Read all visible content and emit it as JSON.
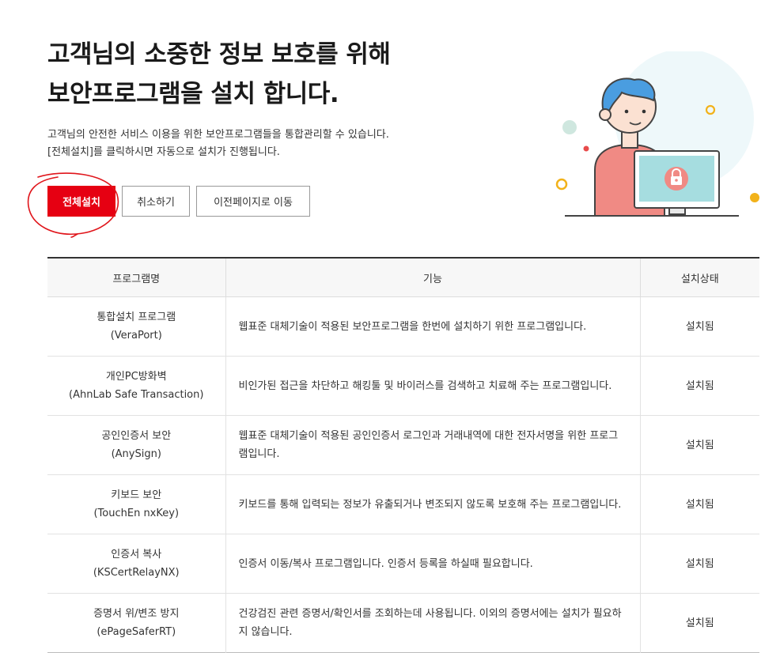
{
  "header": {
    "title_line1": "고객님의 소중한 정보 보호를 위해",
    "title_line2": "보안프로그램을 설치 합니다.",
    "desc_line1": "고객님의 안전한 서비스 이용을 위한 보안프로그램들을 통합관리할 수 있습니다.",
    "desc_line2": "[전체설치]를 클릭하시면 자동으로 설치가 진행됩니다."
  },
  "buttons": {
    "install_all": "전체설치",
    "cancel": "취소하기",
    "back": "이전페이지로 이동"
  },
  "colors": {
    "accent": "#e60012",
    "annotation": "#e0151b",
    "illust_shirt": "#f08a84",
    "illust_hair": "#4a9de0",
    "illust_screen": "#a6dde0"
  },
  "table": {
    "headers": [
      "프로그램명",
      "기능",
      "설치상태"
    ],
    "rows": [
      {
        "name": "통합설치 프로그램",
        "code": "(VeraPort)",
        "func": "웹표준 대체기술이 적용된 보안프로그램을 한번에 설치하기 위한 프로그램입니다.",
        "status": "설치됨"
      },
      {
        "name": "개인PC방화벽",
        "code": "(AhnLab Safe Transaction)",
        "func": "비인가된 접근을 차단하고 해킹툴 및 바이러스를 검색하고 치료해 주는 프로그램입니다.",
        "status": "설치됨"
      },
      {
        "name": "공인인증서 보안",
        "code": "(AnySign)",
        "func": "웹표준 대체기술이 적용된 공인인증서 로그인과 거래내역에 대한 전자서명을 위한 프로그램입니다.",
        "status": "설치됨"
      },
      {
        "name": "키보드 보안",
        "code": "(TouchEn nxKey)",
        "func": "키보드를 통해 입력되는 정보가 유출되거나 변조되지 않도록 보호해 주는 프로그램입니다.",
        "status": "설치됨"
      },
      {
        "name": "인증서 복사",
        "code": "(KSCertRelayNX)",
        "func": "인증서 이동/복사 프로그램입니다. 인증서 등록을 하실때 필요합니다.",
        "status": "설치됨"
      },
      {
        "name": "증명서 위/변조 방지",
        "code": "(ePageSaferRT)",
        "func": "건강검진 관련 증명서/확인서를 조회하는데 사용됩니다. 이외의 증명서에는 설치가 필요하지 않습니다.",
        "status": "설치됨"
      }
    ]
  }
}
